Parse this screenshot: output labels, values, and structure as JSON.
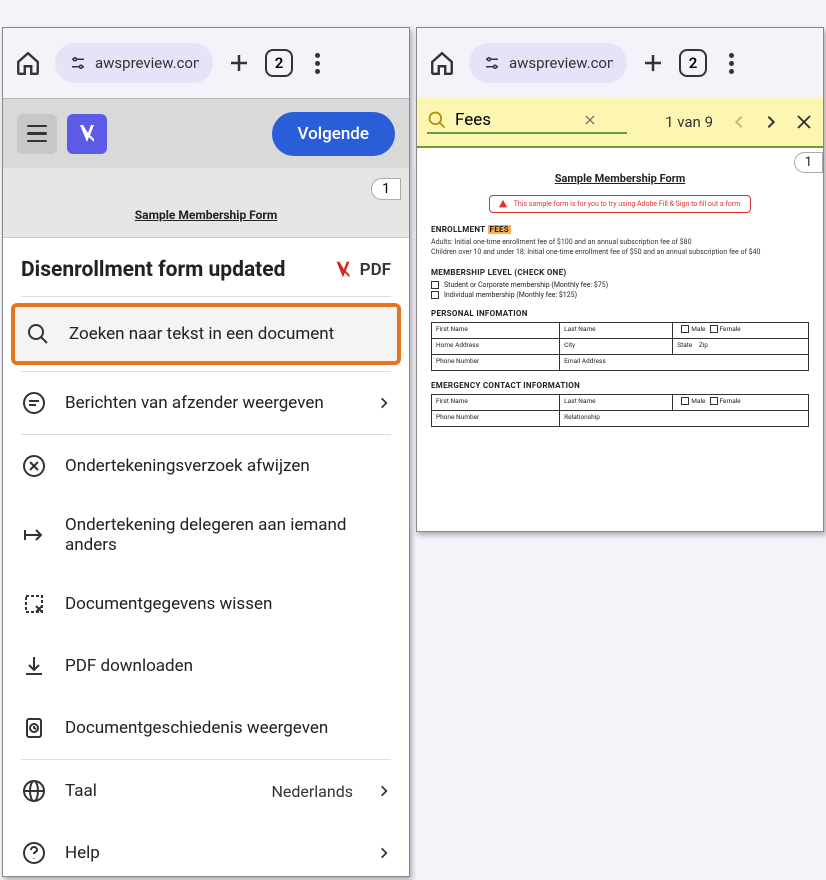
{
  "browser": {
    "url_display": "awspreview.com",
    "tab_count": "2"
  },
  "left": {
    "volgende": "Volgende",
    "doc_title": "Sample Membership Form",
    "page_num": "1",
    "sheet_title": "Disenrollment form updated",
    "pdf_label": "PDF",
    "menu": {
      "search": "Zoeken naar tekst in een document",
      "messages": "Berichten van afzender weergeven",
      "reject": "Ondertekeningsverzoek afwijzen",
      "delegate": "Ondertekening delegeren aan iemand anders",
      "clear": "Documentgegevens wissen",
      "download": "PDF downloaden",
      "history": "Documentgeschiedenis weergeven",
      "language_label": "Taal",
      "language_value": "Nederlands",
      "help": "Help"
    }
  },
  "right": {
    "find_value": "Fees",
    "find_count": "1 van 9",
    "page_num": "1",
    "doc": {
      "title": "Sample Membership Form",
      "notice": "This sample form is for you to try using Adobe Fill & Sign to fill out a form.",
      "enroll_label": "ENROLLMENT ",
      "fees_word": "FEES",
      "adults_line": "Adults: Initial one-time enrollment fee of $100 and an annual subscription fee of $80",
      "children_line": "Children over 10 and under 18: Initial one-time enrollment fee of $50 and an annual subscription fee of $40",
      "membership_label": "MEMBERSHIP LEVEL (CHECK ONE)",
      "opt1": "Student or Corporate membership (Monthly fee: $75)",
      "opt2": "Individual membership (Monthly fee: $125)",
      "personal_label": "PERSONAL INFOMATION",
      "first_name": "First Name",
      "last_name": "Last Name",
      "male": "Male",
      "female": "Female",
      "home_address": "Home Address",
      "city": "City",
      "state": "State",
      "zip": "Zip",
      "phone": "Phone Number",
      "email": "Email Address",
      "emergency_label": "EMERGENCY CONTACT INFORMATION",
      "relationship": "Relationship"
    }
  }
}
